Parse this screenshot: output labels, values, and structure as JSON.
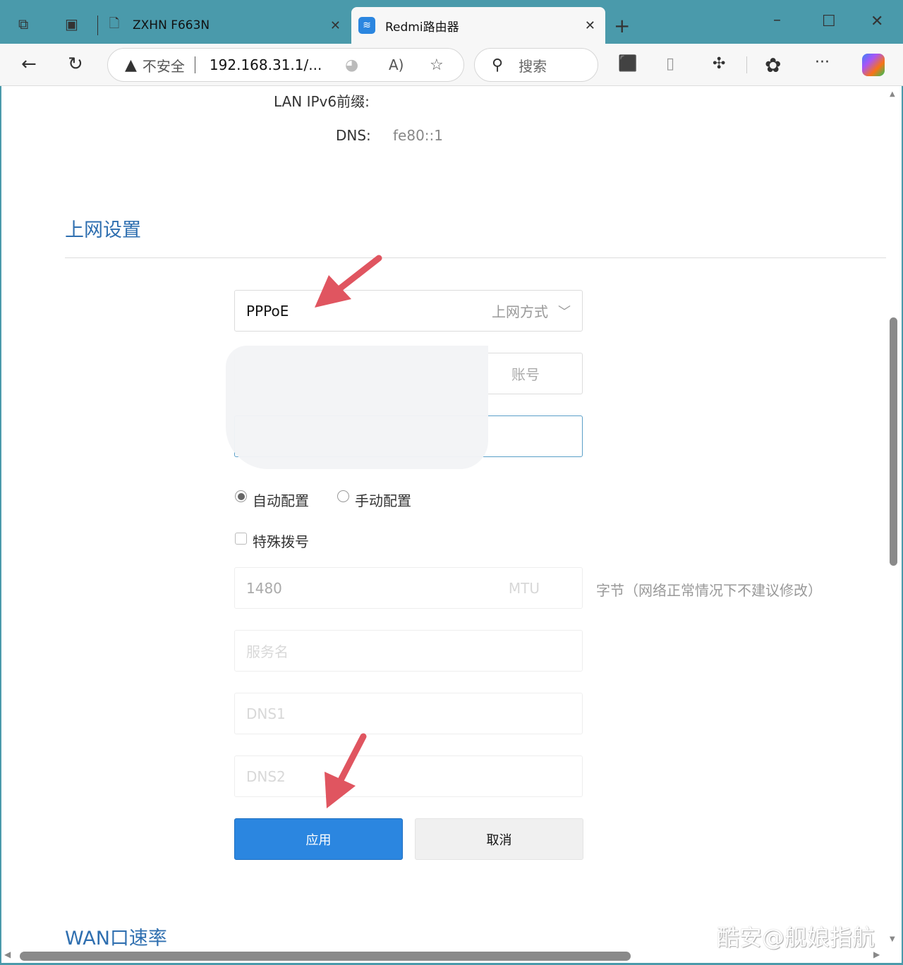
{
  "browser": {
    "tabs": [
      {
        "title": "ZXHN F663N",
        "icon": "page-icon"
      },
      {
        "title": "Redmi路由器",
        "icon": "wifi-icon"
      }
    ],
    "address": {
      "security": "不安全",
      "url": "192.168.31.1/..."
    },
    "search_placeholder": "搜索"
  },
  "lan": {
    "ipv6_prefix_label": "LAN IPv6前缀:",
    "dns_label": "DNS:",
    "dns_value": "fe80::1"
  },
  "section": {
    "title": "上网设置",
    "connection_type": {
      "value": "PPPoE",
      "label": "上网方式"
    },
    "account_label": "账号",
    "config_options": [
      {
        "label": "自动配置",
        "selected": true
      },
      {
        "label": "手动配置",
        "selected": false
      }
    ],
    "special_dial": {
      "label": "特殊拨号",
      "checked": false
    },
    "mtu": {
      "value": "1480",
      "label": "MTU",
      "hint": "字节（网络正常情况下不建议修改）"
    },
    "service_name_placeholder": "服务名",
    "dns1_placeholder": "DNS1",
    "dns2_placeholder": "DNS2",
    "apply": "应用",
    "cancel": "取消"
  },
  "next_section_title": "WAN口速率",
  "watermark": "酷安@舰娘指航",
  "colors": {
    "accent": "#2b86e0",
    "heading": "#2f6fb0",
    "arrow": "#e05560",
    "tabbar": "#4a9aab"
  }
}
